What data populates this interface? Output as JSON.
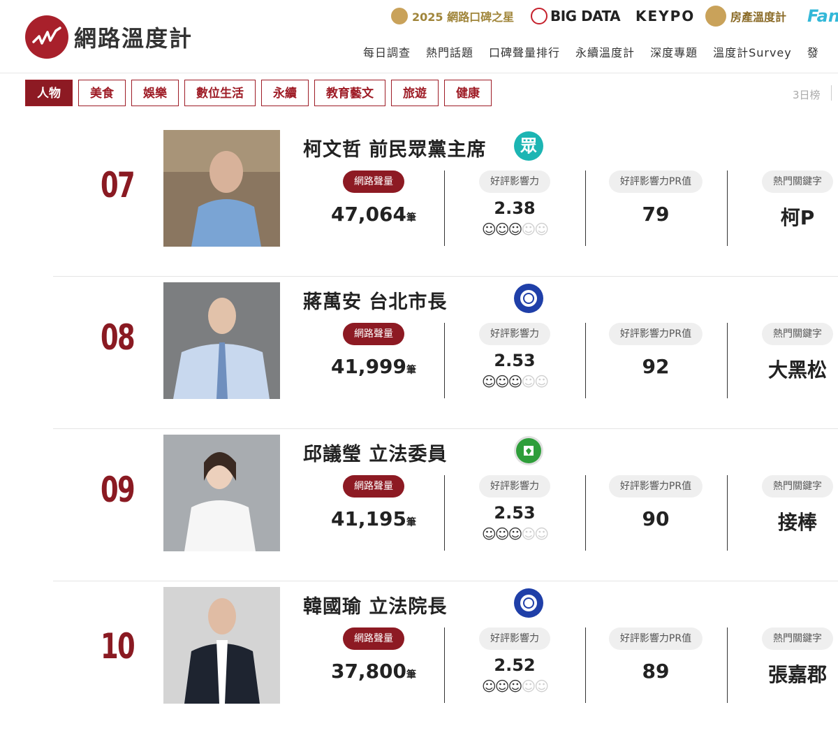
{
  "header": {
    "logo_text": "網路溫度計",
    "brands": {
      "award": "2025 網路口碑之星",
      "bigdata": "BIG DATA",
      "keypo": "KEYPO",
      "house": "房產溫度計",
      "fan": "Fan"
    },
    "nav": [
      "每日調查",
      "熱門話題",
      "口碑聲量排行",
      "永續溫度計",
      "深度專題",
      "溫度計Survey",
      "發"
    ]
  },
  "categories": [
    "人物",
    "美食",
    "娛樂",
    "數位生活",
    "永續",
    "教育藝文",
    "旅遊",
    "健康"
  ],
  "period": "3日榜",
  "labels": {
    "volume": "網路聲量",
    "influence": "好評影響力",
    "pr": "好評影響力PR值",
    "keyword": "熱門關鍵字",
    "unit": "筆"
  },
  "items": [
    {
      "rank": "07",
      "name": "柯文哲  前民眾黨主席",
      "party": "tpp-icon",
      "party_label": "眾",
      "volume": "47,064",
      "influence": "2.38",
      "stars": 3,
      "pr": "79",
      "keyword": "柯P"
    },
    {
      "rank": "08",
      "name": "蔣萬安  台北市長",
      "party": "kmt-icon",
      "volume": "41,999",
      "influence": "2.53",
      "stars": 3,
      "pr": "92",
      "keyword": "大黑松"
    },
    {
      "rank": "09",
      "name": "邱議瑩  立法委員",
      "party": "dpp-icon",
      "volume": "41,195",
      "influence": "2.53",
      "stars": 3,
      "pr": "90",
      "keyword": "接棒"
    },
    {
      "rank": "10",
      "name": "韓國瑜  立法院長",
      "party": "kmt-icon",
      "volume": "37,800",
      "influence": "2.52",
      "stars": 3,
      "pr": "89",
      "keyword": "張嘉郡"
    }
  ],
  "colors": {
    "brand_red": "#8d1a23",
    "logo_red": "#a8202b"
  }
}
